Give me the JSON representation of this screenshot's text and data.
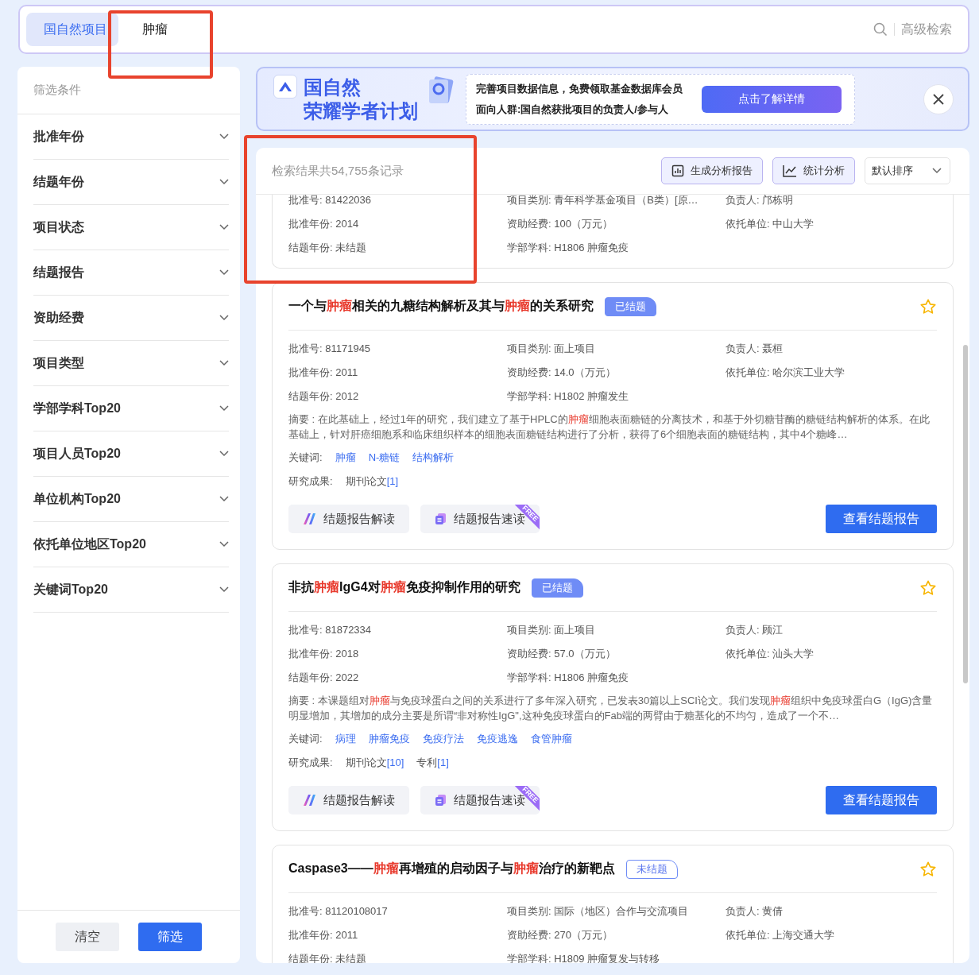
{
  "search_bar": {
    "scope_tab": {
      "label": "国自然项目",
      "selected": true
    },
    "query": "肿瘤",
    "advanced_link": "高级检索"
  },
  "sidebar": {
    "title": "筛选条件",
    "filters": [
      {
        "label": "批准年份",
        "expanded": false
      },
      {
        "label": "结题年份",
        "expanded": false
      },
      {
        "label": "项目状态",
        "expanded": false
      },
      {
        "label": "结题报告",
        "expanded": false
      },
      {
        "label": "资助经费",
        "expanded": false
      },
      {
        "label": "项目类型",
        "expanded": false
      },
      {
        "label": "学部学科Top20",
        "expanded": false
      },
      {
        "label": "项目人员Top20",
        "expanded": false
      },
      {
        "label": "单位机构Top20",
        "expanded": false
      },
      {
        "label": "依托单位地区Top20",
        "expanded": false
      },
      {
        "label": "关键词Top20",
        "expanded": false
      }
    ],
    "clear_button": "清空",
    "apply_button": "筛选"
  },
  "banner": {
    "title_top": "国自然",
    "title_bottom": "荣耀学者计划",
    "line_1": "完善项目数据信息，免费领取基金数据库会员",
    "line_2": "面向人群:国自然获批项目的负责人/参与人",
    "cta": "点击了解详情"
  },
  "results": {
    "count_text": "检索结果共54,755条记录",
    "report_button": "生成分析报告",
    "stats_button": "统计分析",
    "sort": "默认排序",
    "items": [
      {
        "kind": "partial",
        "meta": [
          [
            "批准号: 81422036",
            "项目类别: 青年科学基金项目（B类）[原…",
            "负责人: 邝栋明"
          ],
          [
            "批准年份: 2014",
            "资助经费: 100（万元）",
            "依托单位: 中山大学"
          ],
          [
            "结题年份: 未结题",
            "学部学科: H1806 肿瘤免疫"
          ]
        ]
      },
      {
        "kind": "full",
        "title": [
          {
            "text": "一个与",
            "highlight": false
          },
          {
            "text": "肿瘤",
            "highlight": true
          },
          {
            "text": "相关的九糖结构解析及其与",
            "highlight": false
          },
          {
            "text": "肿瘤",
            "highlight": true
          },
          {
            "text": "的关系研究",
            "highlight": false
          }
        ],
        "status": {
          "kind": "closed",
          "label": "已结题"
        },
        "starred": false,
        "meta": [
          [
            "批准号: 81171945",
            "项目类别: 面上项目",
            "负责人: 聂桓"
          ],
          [
            "批准年份: 2011",
            "资助经费: 14.0（万元）",
            "依托单位: 哈尔滨工业大学"
          ],
          [
            "结题年份: 2012",
            "学部学科: H1802 肿瘤发生"
          ]
        ],
        "abstract": [
          {
            "text": "摘要 : 在此基础上，经过1年的研究，我们建立了基于HPLC的",
            "highlight": false
          },
          {
            "text": "肿瘤",
            "highlight": true
          },
          {
            "text": "细胞表面糖链的分离技术，和基于外切糖苷酶的糖链结构解析的体系。在此基础上，针对肝癌细胞系和临床组织样本的细胞表面糖链结构进行了分析，获得了6个细胞表面的糖链结构，其中4个糖峰…",
            "highlight": false
          }
        ],
        "keywords_label": "关键词:",
        "keywords": [
          "肿瘤",
          "N-糖链",
          "结构解析"
        ],
        "outputs_label": "研究成果:",
        "outputs": [
          {
            "label": "期刊论文",
            "count": "[1]"
          }
        ],
        "actions": {
          "interpret": "结题报告解读",
          "quick_read": "结题报告速读",
          "free_badge": "FREE",
          "view": "查看结题报告"
        }
      },
      {
        "kind": "full",
        "title": [
          {
            "text": "非抗",
            "highlight": false
          },
          {
            "text": "肿瘤",
            "highlight": true
          },
          {
            "text": "IgG4对",
            "highlight": false
          },
          {
            "text": "肿瘤",
            "highlight": true
          },
          {
            "text": "免疫抑制作用的研究",
            "highlight": false
          }
        ],
        "status": {
          "kind": "closed",
          "label": "已结题"
        },
        "starred": false,
        "meta": [
          [
            "批准号: 81872334",
            "项目类别: 面上项目",
            "负责人: 顾江"
          ],
          [
            "批准年份: 2018",
            "资助经费: 57.0（万元）",
            "依托单位: 汕头大学"
          ],
          [
            "结题年份: 2022",
            "学部学科: H1806 肿瘤免疫"
          ]
        ],
        "abstract": [
          {
            "text": "摘要 : 本课题组对",
            "highlight": false
          },
          {
            "text": "肿瘤",
            "highlight": true
          },
          {
            "text": "与免疫球蛋白之间的关系进行了多年深入研究，已发表30篇以上SCI论文。我们发现",
            "highlight": false
          },
          {
            "text": "肿瘤",
            "highlight": true
          },
          {
            "text": "组织中免疫球蛋白G（IgG)含量明显增加，其增加的成分主要是所谓“非对称性IgG\",这种免疫球蛋白的Fab端的两臂由于糖基化的不均匀，造成了一个不…",
            "highlight": false
          }
        ],
        "keywords_label": "关键词:",
        "keywords": [
          "病理",
          "肿瘤免疫",
          "免疫疗法",
          "免疫逃逸",
          "食管肿瘤"
        ],
        "outputs_label": "研究成果:",
        "outputs": [
          {
            "label": "期刊论文",
            "count": "[10]"
          },
          {
            "label": "专利",
            "count": "[1]"
          }
        ],
        "actions": {
          "interpret": "结题报告解读",
          "quick_read": "结题报告速读",
          "free_badge": "FREE",
          "view": "查看结题报告"
        }
      },
      {
        "kind": "full",
        "title": [
          {
            "text": "Caspase3——",
            "highlight": false
          },
          {
            "text": "肿瘤",
            "highlight": true
          },
          {
            "text": "再增殖的启动因子与",
            "highlight": false
          },
          {
            "text": "肿瘤",
            "highlight": true
          },
          {
            "text": "治疗的新靶点",
            "highlight": false
          }
        ],
        "status": {
          "kind": "open",
          "label": "未结题"
        },
        "starred": false,
        "meta": [
          [
            "批准号: 81120108017",
            "项目类别: 国际（地区）合作与交流项目",
            "负责人: 黄倩"
          ],
          [
            "批准年份: 2011",
            "资助经费: 270（万元）",
            "依托单位: 上海交通大学"
          ],
          [
            "结题年份: 未结题",
            "学部学科: H1809 肿瘤复发与转移"
          ]
        ]
      }
    ]
  },
  "highlights": [
    {
      "kind": "frame"
    },
    {
      "kind": "frame"
    }
  ]
}
